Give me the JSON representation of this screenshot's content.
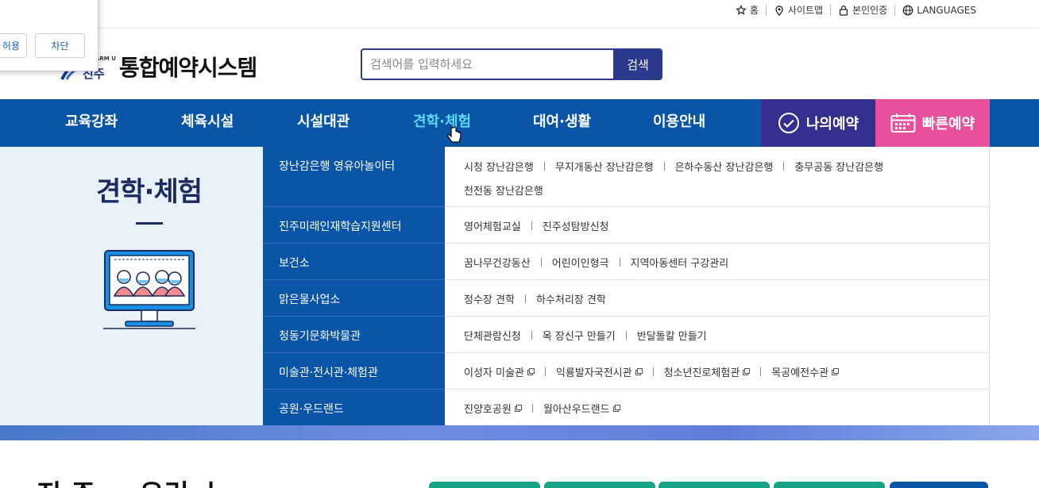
{
  "util": {
    "home": "홈",
    "sitemap": "사이트맵",
    "verify": "본인인증",
    "languages": "LANGUAGES"
  },
  "popup": {
    "allow": "허용",
    "block": "차단"
  },
  "header": {
    "logo_farm": "ARM U",
    "logo_city": "진주",
    "title": "통합예약시스템"
  },
  "search": {
    "placeholder": "검색어를 입력하세요",
    "button": "검색"
  },
  "nav": {
    "items": [
      "교육강좌",
      "체육시설",
      "시설대관",
      "견학·체험",
      "대여·생활",
      "이용안내"
    ],
    "active_index": 3,
    "my_reservation": "나의예약",
    "quick_reservation": "빠른예약"
  },
  "mega": {
    "title": "견학·체험",
    "categories": [
      "장난감은행 영유아놀이터",
      "진주미래인재학습지원센터",
      "보건소",
      "맑은물사업소",
      "청동기문화박물관",
      "미술관·전시관·체험관",
      "공원·우드랜드"
    ],
    "subs": [
      [
        "시청 장난감은행",
        "무지개동산 장난감은행",
        "은하수동산 장난감은행",
        "충무공동 장난감은행",
        "천전동 장난감은행"
      ],
      [
        "영어체험교실",
        "진주성탐방신청"
      ],
      [
        "꿈나무건강동산",
        "어린이인형극",
        "지역아동센터 구강관리"
      ],
      [
        "정수장 견학",
        "하수처리장 견학"
      ],
      [
        "단체관람신청",
        "옥 장신구 만들기",
        "반달돌칼 만들기"
      ],
      [
        "이성자 미술관",
        "익룡발자국전시관",
        "청소년진로체험관",
        "목공예전수관"
      ],
      [
        "진양호공원",
        "월아산우드랜드"
      ]
    ]
  },
  "bottom": {
    "title": "진 주 ㅡ 유린 ㅣ"
  },
  "colors": {
    "nav_bg": "#0a55a8",
    "nav_active": "#5cd9f2",
    "my_reservation_bg": "#35308f",
    "quick_reservation_bg": "#e9509c",
    "search_border": "#2b3a8c"
  }
}
